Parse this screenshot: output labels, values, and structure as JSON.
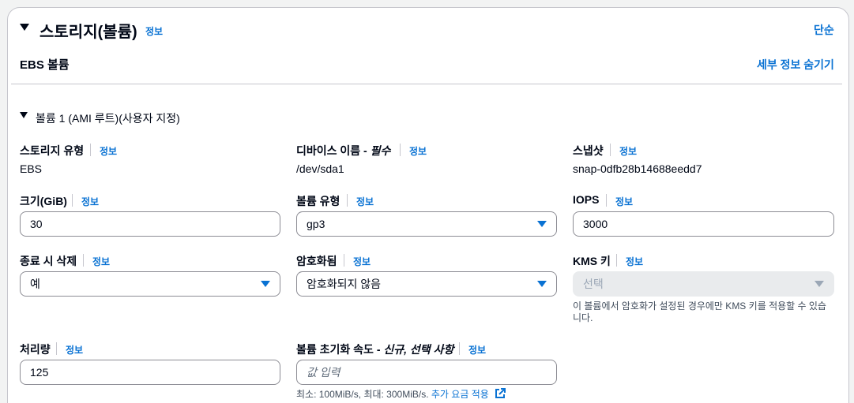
{
  "header": {
    "title": "스토리지(볼륨)",
    "info": "정보",
    "simple_link": "단순"
  },
  "ebs": {
    "title": "EBS 볼륨",
    "hide_details": "세부 정보 숨기기"
  },
  "volume": {
    "title": "볼륨 1 (AMI 루트)(사용자 지정)",
    "storage_type": {
      "label": "스토리지 유형",
      "info": "정보",
      "value": "EBS"
    },
    "device_name": {
      "label_prefix": "디바이스 이름 - ",
      "label_required": "필수",
      "info": "정보",
      "value": "/dev/sda1"
    },
    "snapshot": {
      "label": "스냅샷",
      "info": "정보",
      "value": "snap-0dfb28b14688eedd7"
    },
    "size": {
      "label": "크기(GiB)",
      "info": "정보",
      "value": "30"
    },
    "volume_type": {
      "label": "볼륨 유형",
      "info": "정보",
      "value": "gp3"
    },
    "iops": {
      "label": "IOPS",
      "info": "정보",
      "value": "3000"
    },
    "delete_on_termination": {
      "label": "종료 시 삭제",
      "info": "정보",
      "value": "예"
    },
    "encrypted": {
      "label": "암호화됨",
      "info": "정보",
      "value": "암호화되지 않음"
    },
    "kms_key": {
      "label": "KMS 키",
      "info": "정보",
      "placeholder": "선택",
      "hint_line1": "이 볼륨에서 암호화가 설정된 경우에만 KMS 키를 적용할 수 있습",
      "hint_line2": "니다."
    },
    "throughput": {
      "label": "처리량",
      "info": "정보",
      "value": "125"
    },
    "init_rate": {
      "label_prefix": "볼륨 초기화 속도 - ",
      "label_optional": "신규, 선택 사항",
      "info": "정보",
      "placeholder": "값 입력",
      "hint": "최소: 100MiB/s, 최대: 300MiB/s.",
      "hint_link": "추가 요금 적용"
    }
  },
  "colors": {
    "link": "#0972d3",
    "border": "#8c8c94",
    "text": "#000716"
  }
}
